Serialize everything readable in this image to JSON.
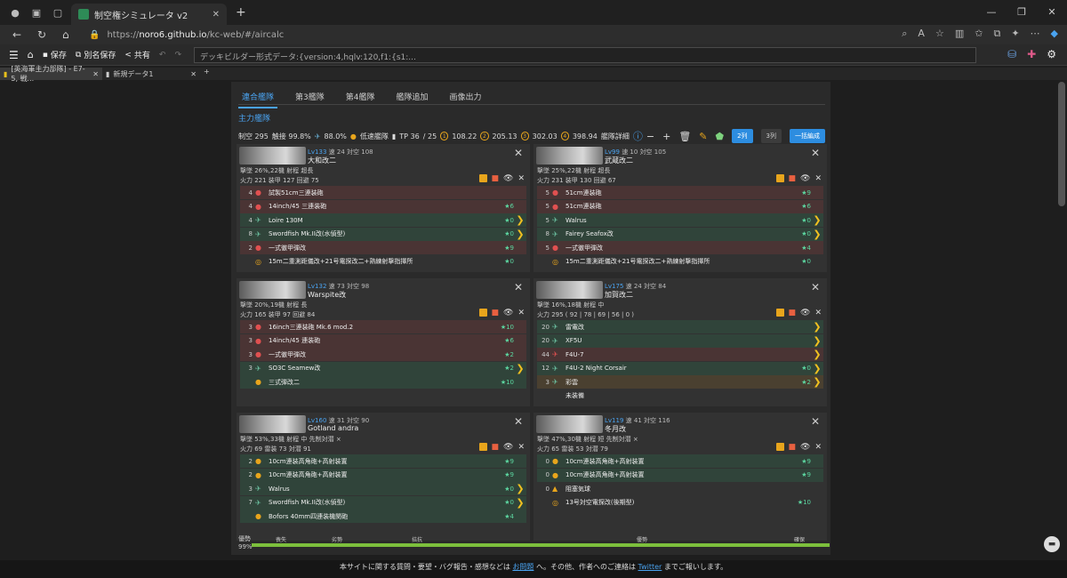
{
  "browser": {
    "tab_title": "制空権シミュレータ v2",
    "url_prefix": "https://",
    "url_host": "noro6.github.io",
    "url_path": "/kc-web/#/aircalc"
  },
  "toolbar": {
    "save": "保存",
    "save_as": "別名保存",
    "share": "共有",
    "deck_builder": "デッキビルダー形式データ:{version:4,hqlv:120,f1:{s1:..."
  },
  "doc_tabs": [
    {
      "label": "[英海軍主力部隊] - E7-5, 戦..."
    },
    {
      "label": "新規データ1"
    }
  ],
  "fleet_tabs": [
    "連合艦隊",
    "第3艦隊",
    "第4艦隊",
    "艦隊追加",
    "画像出力"
  ],
  "fleet_name": "主力艦隊",
  "stats": {
    "air": "制空 295",
    "contact": "触接 99.8%",
    "fighter": "88.0%",
    "speed": "低速艦隊",
    "tp": "TP 36",
    "tp2": "/ 25",
    "a1": "108.22",
    "a2": "205.13",
    "a3": "302.03",
    "a4": "398.94",
    "detail": "艦隊詳細",
    "col2": "2列",
    "col3": "3列",
    "bulk": "一括編成"
  },
  "ships": [
    {
      "lv": "Lv133",
      "spd": "速 24",
      "asw": "対空 108",
      "name": "大和改二",
      "l1": "撃墜 26%,22機 射程 超長",
      "l2": "火力 221 装甲 127 回避 75",
      "equips": [
        {
          "c": "4",
          "n": "試製51cm三連装砲",
          "s": "",
          "cls": "red",
          "ic": "●"
        },
        {
          "c": "4",
          "n": "14inch/45 三連装砲",
          "s": "★6",
          "cls": "red",
          "ic": "●"
        },
        {
          "c": "4",
          "n": "Loire 130M",
          "s": "★0",
          "cls": "green",
          "ic": "✈",
          "ch": "❯"
        },
        {
          "c": "8",
          "n": "Swordfish Mk.II改(水偵型)",
          "s": "★0",
          "cls": "green",
          "ic": "✈",
          "ch": "❯"
        },
        {
          "c": "2",
          "n": "一式徹甲弾改",
          "s": "★9",
          "cls": "red",
          "ic": "●"
        },
        {
          "c": "",
          "n": "15m二重測距儀改+21号電探改二+熟練射撃指揮所",
          "s": "★0",
          "cls": "none",
          "ic": "◎"
        }
      ]
    },
    {
      "lv": "Lv99",
      "spd": "速 10",
      "asw": "対空 105",
      "name": "武蔵改二",
      "l1": "撃墜 25%,22機 射程 超長",
      "l2": "火力 231 装甲 130 回避 67",
      "equips": [
        {
          "c": "5",
          "n": "51cm連装砲",
          "s": "★9",
          "cls": "red",
          "ic": "●"
        },
        {
          "c": "5",
          "n": "51cm連装砲",
          "s": "★6",
          "cls": "red",
          "ic": "●"
        },
        {
          "c": "5",
          "n": "Walrus",
          "s": "★0",
          "cls": "green",
          "ic": "✈",
          "ch": "❯"
        },
        {
          "c": "8",
          "n": "Fairey Seafox改",
          "s": "★0",
          "cls": "green",
          "ic": "✈",
          "ch": "❯"
        },
        {
          "c": "5",
          "n": "一式徹甲弾改",
          "s": "★4",
          "cls": "red",
          "ic": "●"
        },
        {
          "c": "",
          "n": "15m二重測距儀改+21号電探改二+熟練射撃指揮所",
          "s": "★0",
          "cls": "none",
          "ic": "◎"
        }
      ]
    },
    {
      "lv": "Lv132",
      "spd": "速 73",
      "asw": "対空 98",
      "name": "Warspite改",
      "l1": "撃墜 20%,19機 射程 長",
      "l2": "火力 165 装甲 97 回避 84",
      "equips": [
        {
          "c": "3",
          "n": "16inch三連装砲 Mk.6 mod.2",
          "s": "★10",
          "cls": "red",
          "ic": "●"
        },
        {
          "c": "3",
          "n": "14inch/45 連装砲",
          "s": "★6",
          "cls": "red",
          "ic": "●"
        },
        {
          "c": "3",
          "n": "一式徹甲弾改",
          "s": "★2",
          "cls": "red",
          "ic": "●"
        },
        {
          "c": "3",
          "n": "SO3C Seamew改",
          "s": "★2",
          "cls": "green",
          "ic": "✈",
          "ch": "❯"
        },
        {
          "c": "",
          "n": "三式弾改二",
          "s": "★10",
          "cls": "green",
          "ic": "●"
        }
      ]
    },
    {
      "lv": "Lv175",
      "spd": "速 24",
      "asw": "対空 84",
      "name": "加賀改二",
      "l1": "撃墜 16%,18機 射程 中",
      "l2": "火力 295 ( 92 | 78 | 69 | 56 | 0 )",
      "equips": [
        {
          "c": "20",
          "n": "雷電改",
          "s": "",
          "cls": "green",
          "ic": "✈",
          "ch": "❯"
        },
        {
          "c": "20",
          "n": "XF5U",
          "s": "",
          "cls": "green",
          "ic": "✈",
          "ch": "❯"
        },
        {
          "c": "44",
          "n": "F4U-7",
          "s": "",
          "cls": "red",
          "ic": "✈",
          "ch": "❯"
        },
        {
          "c": "12",
          "n": "F4U-2 Night Corsair",
          "s": "★0",
          "cls": "green",
          "ic": "✈",
          "ch": "❯"
        },
        {
          "c": "3",
          "n": "彩雲",
          "s": "★2",
          "cls": "yellow",
          "ic": "✈",
          "ch": "❯"
        },
        {
          "c": "",
          "n": "未装備",
          "s": "",
          "cls": "none",
          "ic": ""
        }
      ]
    },
    {
      "lv": "Lv160",
      "spd": "速 31",
      "asw": "対空 90",
      "name": "Gotland andra",
      "l1": "撃墜 53%,33機 射程 中 先制対潜 ×",
      "l2": "火力 69 雷装 73 対潜 91",
      "equips": [
        {
          "c": "2",
          "n": "10cm連装高角砲+高射装置",
          "s": "★9",
          "cls": "green",
          "ic": "●"
        },
        {
          "c": "2",
          "n": "10cm連装高角砲+高射装置",
          "s": "★9",
          "cls": "green",
          "ic": "●"
        },
        {
          "c": "3",
          "n": "Walrus",
          "s": "★0",
          "cls": "green",
          "ic": "✈",
          "ch": "❯"
        },
        {
          "c": "7",
          "n": "Swordfish Mk.II改(水偵型)",
          "s": "★0",
          "cls": "green",
          "ic": "✈",
          "ch": "❯"
        },
        {
          "c": "",
          "n": "Bofors 40mm四連装機関砲",
          "s": "★4",
          "cls": "green",
          "ic": "●"
        }
      ]
    },
    {
      "lv": "Lv119",
      "spd": "速 41",
      "asw": "対空 116",
      "name": "冬月改",
      "l1": "撃墜 47%,30機 射程 短 先制対潜 ×",
      "l2": "火力 65 雷装 53 対潜 79",
      "equips": [
        {
          "c": "0",
          "n": "10cm連装高角砲+高射装置",
          "s": "★9",
          "cls": "green",
          "ic": "●"
        },
        {
          "c": "0",
          "n": "10cm連装高角砲+高射装置",
          "s": "★9",
          "cls": "green",
          "ic": "●"
        },
        {
          "c": "0",
          "n": "阻塞気球",
          "s": "",
          "cls": "none",
          "ic": "▲"
        },
        {
          "c": "",
          "n": "13号対空電探改(後期型)",
          "s": "★10",
          "cls": "none",
          "ic": "◎"
        }
      ]
    }
  ],
  "progress": {
    "label1": "優勢",
    "label2": "99%",
    "seg": [
      "喪失",
      "劣勢",
      "拮抗",
      "優勢",
      "確保"
    ]
  },
  "footer": {
    "pre": "本サイトに関する質問・要望・バグ報告・感想などは",
    "link1": "お問題",
    "mid": "へ。その他、作者へのご連絡は",
    "link2": "Twitter",
    "post": "までご報いします。"
  },
  "colors": {
    "accent": "#4aa3f0",
    "bar": "#7cbf3c"
  }
}
